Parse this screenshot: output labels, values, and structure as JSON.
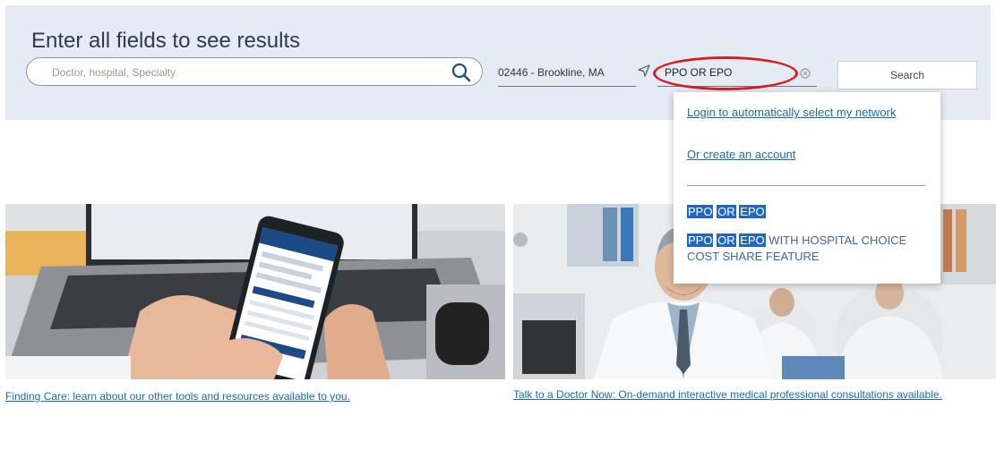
{
  "search_panel": {
    "title": "Enter all fields to see results",
    "query_placeholder": "Doctor, hospital, Specialty",
    "location_value": "02446 - Brookline, MA",
    "network_value": "PPO OR EPO",
    "search_button_label": "Search"
  },
  "network_dropdown": {
    "login_link": "Login to automatically select my network",
    "create_account_link": "Or create an account",
    "options": [
      {
        "tokens": [
          "PPO",
          "OR",
          "EPO"
        ],
        "suffix": ""
      },
      {
        "tokens": [
          "PPO",
          "OR",
          "EPO"
        ],
        "suffix": " WITH HOSPITAL CHOICE COST SHARE FEATURE"
      }
    ]
  },
  "cards": [
    {
      "caption": "Finding Care: learn about our other tools and resources available to you."
    },
    {
      "caption": "Talk to a Doctor Now: On-demand interactive medical professional consultations available."
    }
  ],
  "icons": [
    "search-icon",
    "locate-arrow-icon",
    "clear-icon"
  ],
  "colors": {
    "panel_bg": "#e4ebf2",
    "link": "#1a6aa6",
    "highlight": "#1e67c5",
    "annotation_oval": "#d32027"
  }
}
